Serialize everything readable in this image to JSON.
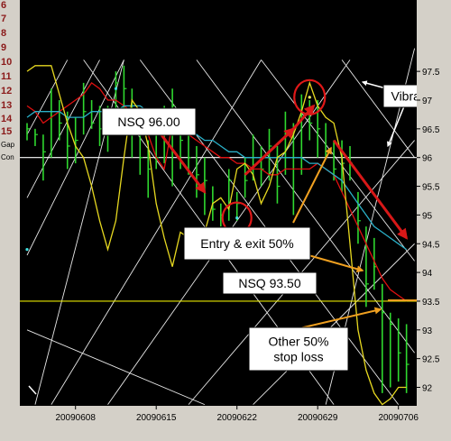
{
  "row_labels": [
    "6",
    "7",
    "8",
    "9",
    "10",
    "11",
    "12",
    "13",
    "14",
    "15",
    "Gap",
    "Con"
  ],
  "chart_data": {
    "type": "line",
    "title": "",
    "xlabel": "",
    "ylabel": "",
    "ylim": [
      91.7,
      98.0
    ],
    "yticks": [
      92,
      92.5,
      93,
      93.5,
      94,
      94.5,
      95,
      95.5,
      96,
      96.5,
      97,
      97.5
    ],
    "ytick_labels": [
      "92",
      "92.5",
      "93",
      "93.5",
      "94",
      "94.5",
      "95",
      "95.5",
      "96",
      "96.5",
      "97",
      "97.5"
    ],
    "xtick_labels": [
      "20090608",
      "20090615",
      "20090622",
      "20090629",
      "20090706"
    ],
    "xtick_bar_index": [
      6,
      16,
      26,
      36,
      46
    ],
    "bars": [
      [
        96.3,
        96.6,
        96.5
      ],
      [
        96.2,
        96.5,
        96.4
      ],
      [
        95.6,
        96.4,
        96.1
      ],
      [
        96.0,
        97.2,
        96.8
      ],
      [
        96.3,
        97.0,
        96.6
      ],
      [
        95.8,
        96.8,
        96.2
      ],
      [
        95.9,
        96.7,
        96.3
      ],
      [
        96.4,
        97.3,
        96.8
      ],
      [
        96.5,
        97.0,
        96.6
      ],
      [
        96.2,
        96.9,
        96.5
      ],
      [
        96.1,
        96.9,
        96.4
      ],
      [
        96.4,
        97.5,
        97.3
      ],
      [
        96.8,
        97.6,
        97.2
      ],
      [
        96.0,
        97.2,
        96.7
      ],
      [
        95.7,
        96.6,
        96.0
      ],
      [
        95.3,
        96.3,
        95.8
      ],
      [
        95.8,
        96.8,
        96.0
      ],
      [
        95.9,
        96.9,
        96.7
      ],
      [
        95.5,
        97.2,
        96.9
      ],
      [
        95.8,
        96.8,
        96.3
      ],
      [
        95.7,
        96.5,
        96.0
      ],
      [
        95.3,
        96.2,
        95.7
      ],
      [
        95.0,
        96.0,
        95.6
      ],
      [
        94.9,
        95.5,
        95.1
      ],
      [
        94.8,
        95.2,
        95.0
      ],
      [
        94.9,
        95.8,
        95.6
      ],
      [
        94.9,
        95.4,
        95.2
      ],
      [
        95.3,
        96.0,
        95.6
      ],
      [
        95.6,
        96.4,
        96.0
      ],
      [
        95.5,
        96.2,
        95.8
      ],
      [
        95.6,
        96.5,
        96.2
      ],
      [
        95.2,
        96.2,
        95.5
      ],
      [
        95.7,
        96.8,
        96.4
      ],
      [
        95.0,
        96.6,
        96.0
      ],
      [
        95.7,
        97.1,
        96.7
      ],
      [
        96.3,
        97.0,
        96.6
      ],
      [
        96.0,
        97.0,
        96.5
      ],
      [
        96.0,
        96.6,
        96.1
      ],
      [
        95.6,
        96.3,
        95.8
      ],
      [
        95.4,
        96.3,
        95.9
      ],
      [
        95.6,
        96.2,
        95.9
      ],
      [
        94.5,
        95.4,
        94.9
      ],
      [
        93.4,
        94.8,
        93.8
      ],
      [
        93.7,
        94.6,
        94.1
      ],
      [
        91.9,
        93.8,
        93.3
      ],
      [
        92.0,
        93.3,
        93.1
      ],
      [
        92.1,
        93.2,
        92.6
      ],
      [
        91.9,
        93.1,
        92.4
      ]
    ],
    "series": [
      {
        "values": [
          96.9,
          96.8,
          96.6,
          96.7,
          96.8,
          96.9,
          97.0,
          97.1,
          97.3,
          97.2,
          97.0,
          97.0,
          96.9,
          96.8,
          96.7,
          96.4,
          96.0,
          95.8,
          96.6,
          96.5,
          96.4,
          96.3,
          96.2,
          96.1,
          96.0,
          96.0,
          95.9,
          95.9,
          95.8,
          95.8,
          95.7,
          95.7,
          95.8,
          95.8,
          95.8,
          95.8,
          95.9,
          95.8,
          95.7,
          95.4,
          95.1,
          94.8,
          94.5,
          94.2,
          93.9,
          93.7,
          93.6,
          93.5
        ]
      },
      {
        "values": [
          96.7,
          96.8,
          96.8,
          96.8,
          96.8,
          96.7,
          96.7,
          96.7,
          96.8,
          96.8,
          96.8,
          96.8,
          96.9,
          96.9,
          96.9,
          96.8,
          96.8,
          96.7,
          96.6,
          96.6,
          96.5,
          96.4,
          96.3,
          96.3,
          96.2,
          96.1,
          96.1,
          96.0,
          96.0,
          96.0,
          96.0,
          96.0,
          96.0,
          96.0,
          96.0,
          95.9,
          95.9,
          95.8,
          95.7,
          95.6,
          95.4,
          95.2,
          95.0,
          94.8,
          94.7,
          94.6,
          94.5,
          94.4
        ]
      },
      {
        "values": [
          97.5,
          97.6,
          97.6,
          97.6,
          97.1,
          96.6,
          96.2,
          96.0,
          95.5,
          94.9,
          94.4,
          94.9,
          96.0,
          97.0,
          96.8,
          96.2,
          95.2,
          94.6,
          94.1,
          94.7,
          94.6,
          94.5,
          94.7,
          95.2,
          95.3,
          95.1,
          95.8,
          95.9,
          95.7,
          95.2,
          95.5,
          96.0,
          96.1,
          96.4,
          96.8,
          97.3,
          96.9,
          96.7,
          96.6,
          96.0,
          94.5,
          93.0,
          92.3,
          91.9,
          91.7,
          91.8,
          92.0,
          92.0
        ]
      }
    ],
    "fan_lines": [
      [
        [
          0,
          94.3
        ],
        [
          12,
          97.7
        ]
      ],
      [
        [
          0,
          95.3
        ],
        [
          9,
          97.7
        ]
      ],
      [
        [
          0,
          96.4
        ],
        [
          5,
          97.7
        ]
      ],
      [
        [
          3,
          91.7
        ],
        [
          29,
          97.7
        ]
      ],
      [
        [
          10,
          91.7
        ],
        [
          40,
          97.7
        ]
      ],
      [
        [
          20,
          91.7
        ],
        [
          48,
          96.3
        ]
      ],
      [
        [
          28,
          91.7
        ],
        [
          48,
          94.5
        ]
      ],
      [
        [
          7,
          97.7
        ],
        [
          38,
          91.7
        ]
      ],
      [
        [
          14,
          97.7
        ],
        [
          46,
          91.7
        ]
      ],
      [
        [
          21,
          97.7
        ],
        [
          48,
          92.6
        ]
      ],
      [
        [
          29,
          97.7
        ],
        [
          48,
          94.2
        ]
      ],
      [
        [
          39,
          97.7
        ],
        [
          48,
          96.0
        ]
      ],
      [
        [
          0,
          93.0
        ],
        [
          22,
          91.7
        ]
      ],
      [
        [
          12,
          97.7
        ],
        [
          1,
          91.7
        ]
      ],
      [
        [
          48,
          97.9
        ],
        [
          37,
          91.7
        ]
      ]
    ],
    "horizontal_lines": [
      {
        "value": 96.0,
        "color": "#ffffff"
      },
      {
        "value": 93.5,
        "color": "#e8e800"
      }
    ],
    "markers": [
      {
        "i": 11,
        "value": 97.2,
        "color": "#40e0e0"
      },
      {
        "i": 26,
        "value": 94.95,
        "color": "#40e0e0"
      },
      {
        "i": 35,
        "value": 97.05,
        "color": "#ffff60"
      },
      {
        "i": 0,
        "value": 94.4,
        "color": "#40e0e0"
      }
    ],
    "annotations": [
      {
        "text": "NSQ 96.00"
      },
      {
        "text": "Vibration"
      },
      {
        "text": "Entry & exit 50%"
      },
      {
        "text": "NSQ 93.50"
      },
      {
        "text": "Other 50%"
      },
      {
        "text": "stop loss"
      }
    ]
  },
  "colors": {
    "background": "#000000",
    "bar": "#2fd82f",
    "ma_fast": "#e01010",
    "ma_slow": "#2ab0c8",
    "price_line": "#e6d820",
    "fan": "#e8e8e8",
    "arrow_red": "#d81818",
    "arrow_orange": "#f0a020",
    "circle": "#e01818"
  }
}
